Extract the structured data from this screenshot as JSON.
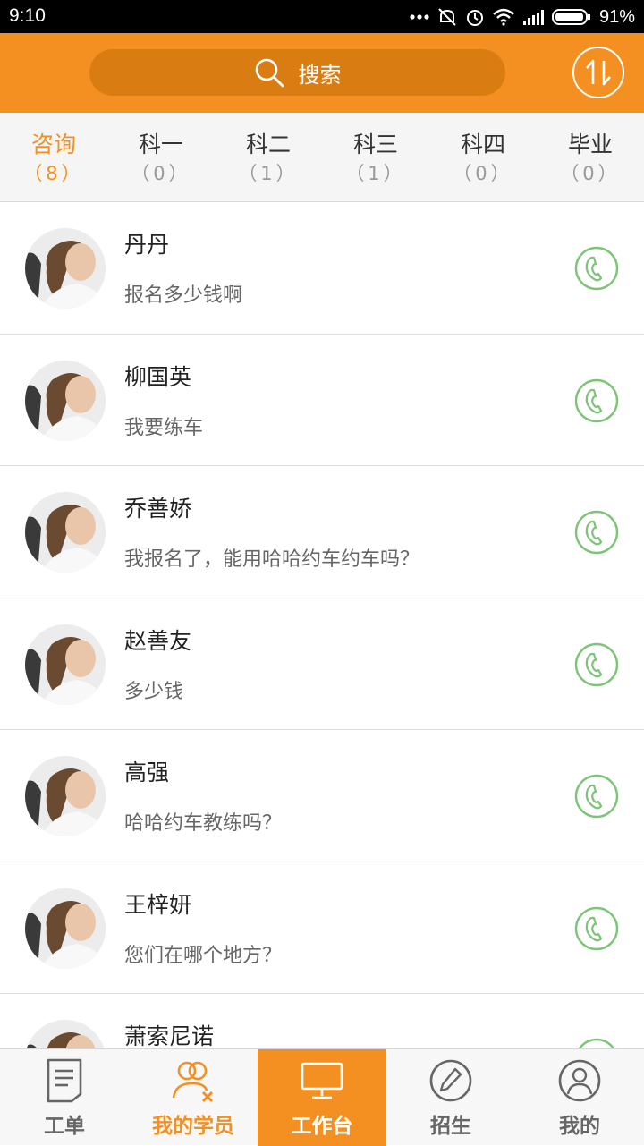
{
  "status_bar": {
    "time": "9:10",
    "battery": "91%"
  },
  "search": {
    "label": "搜索"
  },
  "tabs": [
    {
      "label": "咨询",
      "count": "（8）"
    },
    {
      "label": "科一",
      "count": "（0）"
    },
    {
      "label": "科二",
      "count": "（1）"
    },
    {
      "label": "科三",
      "count": "（1）"
    },
    {
      "label": "科四",
      "count": "（0）"
    },
    {
      "label": "毕业",
      "count": "（0）"
    }
  ],
  "students": [
    {
      "name": "丹丹",
      "message": "报名多少钱啊"
    },
    {
      "name": "柳国英",
      "message": "我要练车"
    },
    {
      "name": "乔善娇",
      "message": "我报名了，能用哈哈约车约车吗？"
    },
    {
      "name": "赵善友",
      "message": "多少钱"
    },
    {
      "name": "高强",
      "message": "哈哈约车教练吗？"
    },
    {
      "name": "王梓妍",
      "message": "您们在哪个地方？"
    },
    {
      "name": "萧索尼诺",
      "message": ""
    }
  ],
  "nav": [
    {
      "label": "工单"
    },
    {
      "label": "我的学员"
    },
    {
      "label": "工作台"
    },
    {
      "label": "招生"
    },
    {
      "label": "我的"
    }
  ],
  "colors": {
    "accent": "#f39021",
    "call_green": "#7cc576"
  }
}
